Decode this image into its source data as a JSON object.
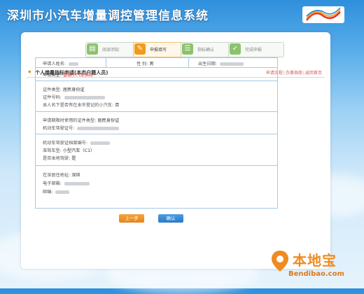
{
  "header": {
    "site_title": "深圳市小汽车增量调控管理信息系统",
    "logo_text": "深圳市 SHENZHEN CHINA"
  },
  "steps": [
    {
      "label": "阅读须知",
      "active": false,
      "icon": "document-icon"
    },
    {
      "label": "申报填写",
      "active": true,
      "icon": "edit-form-icon"
    },
    {
      "label": "指标确认",
      "active": false,
      "icon": "list-icon"
    },
    {
      "label": "完成申报",
      "active": false,
      "icon": "checkmark-icon"
    }
  ],
  "section": {
    "title": "个人增量指标申请(本市户籍人员)",
    "links": [
      "申请流程",
      "办事指南",
      "返回首页"
    ],
    "separator": "|"
  },
  "form": {
    "row1": {
      "name_label": "申请人姓名:",
      "gender_label": "性 别:",
      "gender_value": "男",
      "birth_label": "出生日期:"
    },
    "apply_type_label": "申请类型:",
    "apply_type_value": "普通小汽车指标",
    "id_type_label": "证件类型:",
    "id_type_value": "居民身份证",
    "id_no_label": "证件号码:",
    "owned_car_label": "本人名下是否有在本市登记的小汽车:",
    "owned_car_value": "否",
    "license_id_type_label": "申请期限时使用的证件类型:",
    "license_id_type_value": "居民身份证",
    "license_no_label": "机动车驾驶证号:",
    "license_file_label": "机动车驾驶证档案编号:",
    "vehicle_type_label": "准驾车型:",
    "vehicle_type_value": "小型汽车（C1）",
    "local_label": "是否本地驾驶:",
    "local_value": "是",
    "address_label": "在深居住地址:",
    "address_value": "深圳",
    "email_label": "电子邮箱:",
    "postcode_label": "邮编:"
  },
  "buttons": {
    "prev_label": "上一步",
    "confirm_label": "确认"
  },
  "watermark": {
    "brand": "本地宝",
    "url": "Bendibao.com"
  },
  "colors": {
    "accent_orange": "#f29a1a",
    "accent_blue": "#2a79c4",
    "link_red": "#d9534f",
    "table_border": "#a8c8e4"
  }
}
